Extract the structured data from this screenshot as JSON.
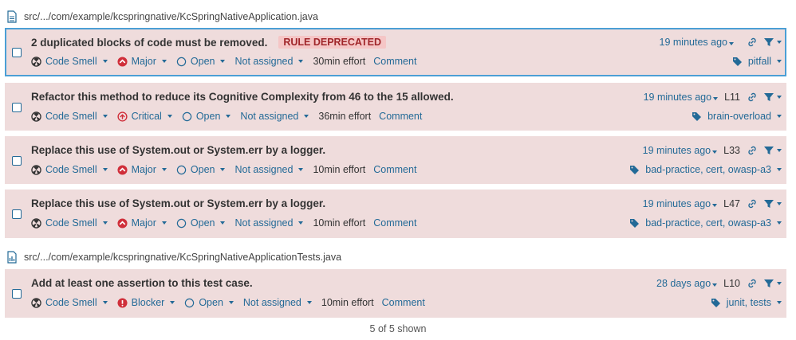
{
  "files": [
    {
      "path": "src/.../com/example/kcspringnative/KcSpringNativeApplication.java"
    },
    {
      "path": "src/.../com/example/kcspringnative/KcSpringNativeApplicationTests.java"
    }
  ],
  "issues": [
    {
      "message": "2 duplicated blocks of code must be removed.",
      "badge": "RULE DEPRECATED",
      "type": "Code Smell",
      "severity": "Major",
      "status": "Open",
      "assignee": "Not assigned",
      "effort": "30min effort",
      "comment": "Comment",
      "age": "19 minutes ago",
      "line": "",
      "tags": "pitfall"
    },
    {
      "message": "Refactor this method to reduce its Cognitive Complexity from 46 to the 15 allowed.",
      "type": "Code Smell",
      "severity": "Critical",
      "status": "Open",
      "assignee": "Not assigned",
      "effort": "36min effort",
      "comment": "Comment",
      "age": "19 minutes ago",
      "line": "L11",
      "tags": "brain-overload"
    },
    {
      "message": "Replace this use of System.out or System.err by a logger.",
      "type": "Code Smell",
      "severity": "Major",
      "status": "Open",
      "assignee": "Not assigned",
      "effort": "10min effort",
      "comment": "Comment",
      "age": "19 minutes ago",
      "line": "L33",
      "tags": "bad-practice, cert, owasp-a3"
    },
    {
      "message": "Replace this use of System.out or System.err by a logger.",
      "type": "Code Smell",
      "severity": "Major",
      "status": "Open",
      "assignee": "Not assigned",
      "effort": "10min effort",
      "comment": "Comment",
      "age": "19 minutes ago",
      "line": "L47",
      "tags": "bad-practice, cert, owasp-a3"
    },
    {
      "message": "Add at least one assertion to this test case.",
      "type": "Code Smell",
      "severity": "Blocker",
      "status": "Open",
      "assignee": "Not assigned",
      "effort": "10min effort",
      "comment": "Comment",
      "age": "28 days ago",
      "line": "L10",
      "tags": "junit, tests"
    }
  ],
  "footer": {
    "count_text": "5 of 5 shown"
  },
  "colors": {
    "accent": "#236a97",
    "issue_bg": "#efdcdc",
    "selected_border": "#4b9fd5",
    "severity_red": "#d02f3a"
  }
}
